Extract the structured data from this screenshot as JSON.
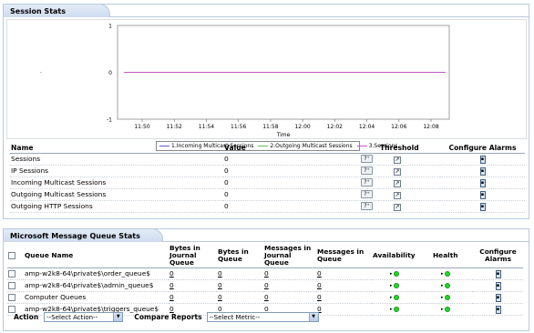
{
  "session_stats": {
    "title": "Session Stats",
    "chart_data": {
      "type": "line",
      "xlabel": "Time",
      "ylabel": "",
      "categories": [
        "11:50",
        "11:52",
        "11:54",
        "11:56",
        "11:58",
        "12:00",
        "12:02",
        "12:04",
        "12:06",
        "12:08"
      ],
      "y_ticks": [
        "1",
        "0",
        "-1"
      ],
      "ylim": [
        -1,
        1
      ],
      "grid": false,
      "legend_position": "bottom",
      "series": [
        {
          "name": "1.Incoming Multicast Sessions",
          "color": "#5a5fc8",
          "values": [
            0,
            0,
            0,
            0,
            0,
            0,
            0,
            0,
            0,
            0
          ]
        },
        {
          "name": "2.Outgoing Multicast Sessions",
          "color": "#5cc25c",
          "values": [
            0,
            0,
            0,
            0,
            0,
            0,
            0,
            0,
            0,
            0
          ]
        },
        {
          "name": "3.Sessions",
          "color": "#c05cc0",
          "values": [
            0,
            0,
            0,
            0,
            0,
            0,
            0,
            0,
            0,
            0
          ]
        }
      ]
    },
    "table": {
      "headers": {
        "name": "Name",
        "value": "Value",
        "threshold": "Threshold",
        "alarms": "Configure Alarms"
      },
      "rows": [
        {
          "name": "Sessions",
          "value": "0"
        },
        {
          "name": "IP Sessions",
          "value": "0"
        },
        {
          "name": "Incoming Multicast Sessions",
          "value": "0"
        },
        {
          "name": "Outgoing Multicast Sessions",
          "value": "0"
        },
        {
          "name": "Outgoing HTTP Sessions",
          "value": "0"
        }
      ]
    }
  },
  "msmq_stats": {
    "title": "Microsoft Message Queue Stats",
    "headers": {
      "queue_name": "Queue Name",
      "bytes_journal": "Bytes in Journal Queue",
      "bytes_queue": "Bytes in Queue",
      "msgs_journal": "Messages in Journal Queue",
      "msgs_queue": "Messages in Queue",
      "availability": "Availability",
      "health": "Health",
      "alarms": "Configure Alarms"
    },
    "rows": [
      {
        "name": "amp-w2k8-64\\private$\\order_queue$",
        "bytes_journal": "0",
        "bytes_queue": "0",
        "msgs_journal": "0",
        "msgs_queue": "0",
        "availability": "up",
        "health": "clear"
      },
      {
        "name": "amp-w2k8-64\\private$\\admin_queue$",
        "bytes_journal": "0",
        "bytes_queue": "0",
        "msgs_journal": "0",
        "msgs_queue": "0",
        "availability": "up",
        "health": "clear"
      },
      {
        "name": "Computer Queues",
        "bytes_journal": "0",
        "bytes_queue": "0",
        "msgs_journal": "0",
        "msgs_queue": "0",
        "availability": "up",
        "health": "clear"
      },
      {
        "name": "amp-w2k8-64\\private$\\triggers_queue$",
        "bytes_journal": "0",
        "bytes_queue": "0",
        "msgs_journal": "0",
        "msgs_queue": "0",
        "availability": "up",
        "health": "clear"
      }
    ],
    "controls": {
      "action_label": "Action",
      "action_value": "--Select Action--",
      "compare_label": "Compare Reports",
      "compare_value": "--Select Metric--"
    },
    "status_color": "#23d72a"
  }
}
